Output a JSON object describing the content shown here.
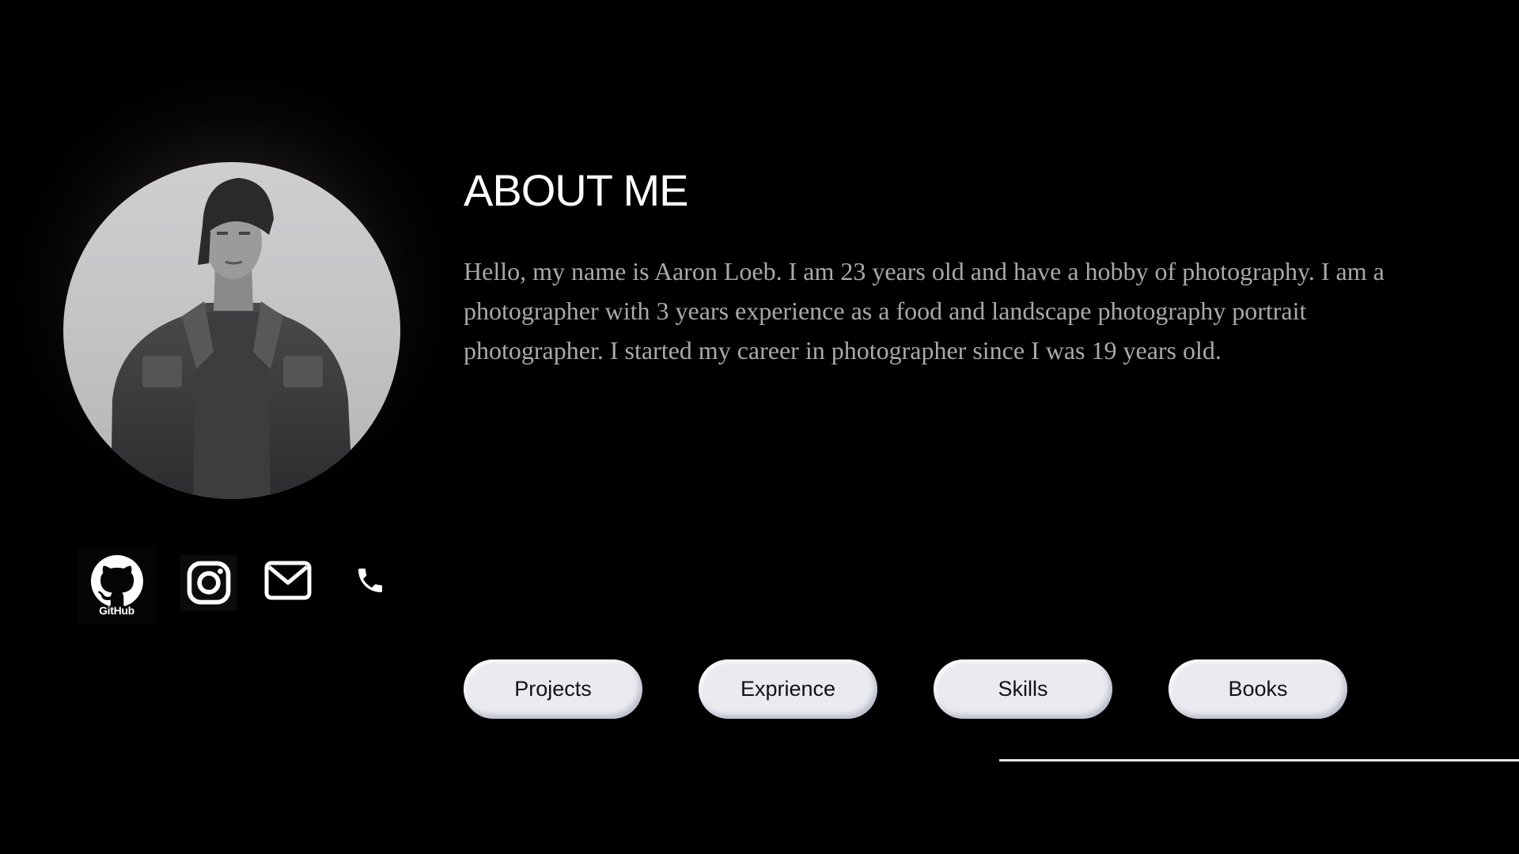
{
  "about": {
    "title": "ABOUT ME",
    "bio": "Hello, my name is Aaron Loeb. I am 23 years old and have a hobby of photography. I am a photographer with 3 years experience as a food and landscape photography portrait photographer. I started my career in photographer since I was 19 years old."
  },
  "social": {
    "github_label": "GitHub",
    "icons": [
      "github-icon",
      "instagram-icon",
      "mail-icon",
      "phone-icon"
    ]
  },
  "nav": {
    "projects": "Projects",
    "experience": "Exprience",
    "skills": "Skills",
    "books": "Books"
  },
  "colors": {
    "background": "#000000",
    "heading": "#ffffff",
    "body_text": "#a9a9a9",
    "button_bg": "#eaebf0",
    "button_text": "#111111"
  }
}
